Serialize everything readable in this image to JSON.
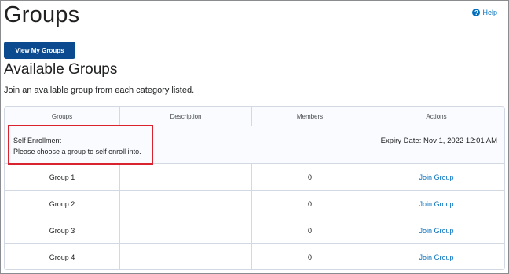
{
  "page": {
    "title": "Groups",
    "help_label": "Help",
    "help_icon": "question-circle-icon"
  },
  "toolbar": {
    "view_my_groups_label": "View My Groups"
  },
  "section": {
    "title": "Available Groups",
    "instruction": "Join an available group from each category listed."
  },
  "table": {
    "headers": [
      "Groups",
      "Description",
      "Members",
      "Actions"
    ],
    "category": {
      "name": "Self Enrollment",
      "description": "Please choose a group to self enroll into.",
      "expiry": "Expiry Date: Nov 1, 2022 12:01 AM"
    },
    "rows": [
      {
        "group": "Group 1",
        "description": "",
        "members": "0",
        "action": "Join Group"
      },
      {
        "group": "Group 2",
        "description": "",
        "members": "0",
        "action": "Join Group"
      },
      {
        "group": "Group 3",
        "description": "",
        "members": "0",
        "action": "Join Group"
      },
      {
        "group": "Group 4",
        "description": "",
        "members": "0",
        "action": "Join Group"
      }
    ]
  },
  "colors": {
    "primary_button": "#0b4a8f",
    "link": "#006fbf",
    "highlight": "#d9232e"
  }
}
